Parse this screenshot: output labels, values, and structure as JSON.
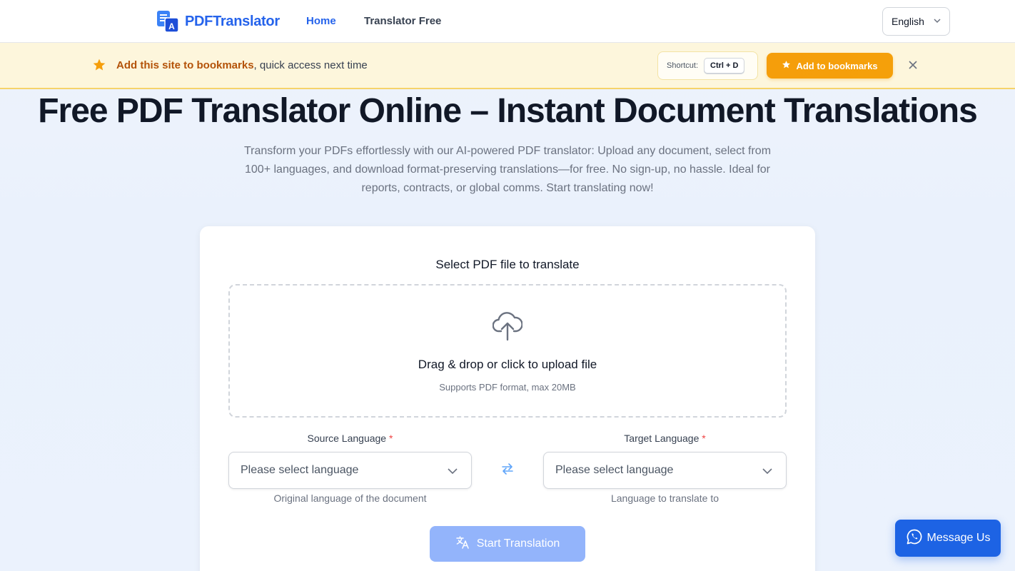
{
  "header": {
    "brand": "PDFTranslator",
    "nav": {
      "home": "Home",
      "translator_free": "Translator Free"
    },
    "language": "English"
  },
  "banner": {
    "highlight": "Add this site to bookmarks",
    "rest": ", quick access next time",
    "shortcut_label": "Shortcut:",
    "shortcut_keys": "Ctrl + D",
    "button": "Add to bookmarks"
  },
  "hero": {
    "title": "Free PDF Translator Online – Instant Document Translations",
    "description": "Transform your PDFs effortlessly with our AI-powered PDF translator: Upload any document, select from 100+ languages, and download format-preserving translations—for free. No sign-up, no hassle. Ideal for reports, contracts, or global comms. Start translating now!"
  },
  "card": {
    "title": "Select PDF file to translate",
    "dropzone": {
      "title": "Drag & drop or click to upload file",
      "subtitle": "Supports PDF format, max 20MB"
    },
    "source": {
      "label": "Source Language",
      "required": "*",
      "placeholder": "Please select language",
      "help": "Original language of the document"
    },
    "target": {
      "label": "Target Language",
      "required": "*",
      "placeholder": "Please select language",
      "help": "Language to translate to"
    },
    "start_button": "Start Translation"
  },
  "message_button": "Message Us",
  "colors": {
    "primary": "#2563eb",
    "accent": "#f59e0b",
    "banner_bg": "#fdf6dc"
  }
}
